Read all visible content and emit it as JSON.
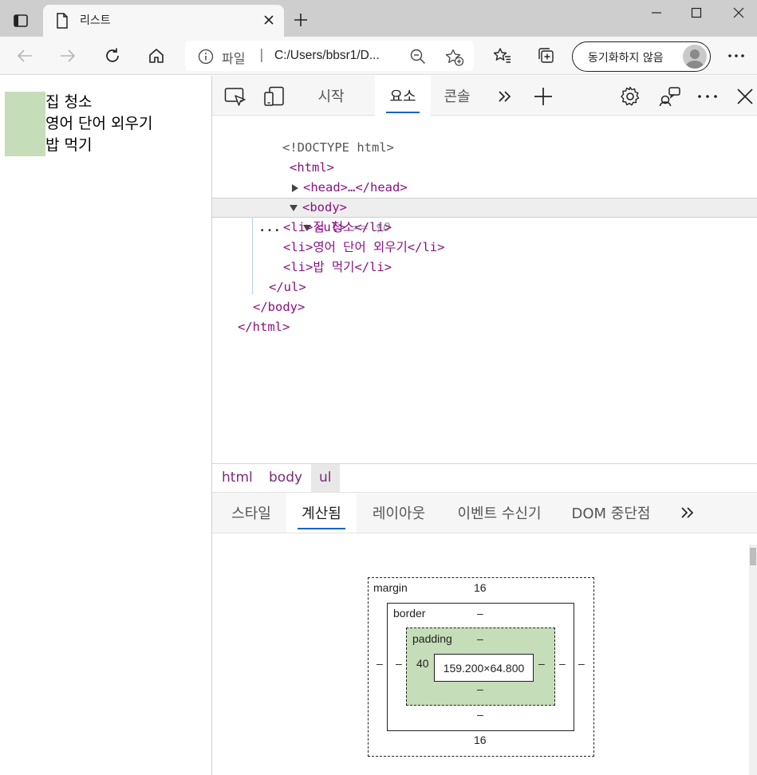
{
  "browser": {
    "tab_title": "리스트",
    "address_scheme": "파일",
    "address_separator": "|",
    "url": "C:/Users/bbsr1/D...",
    "sync_label": "동기화하지 않음"
  },
  "page": {
    "list_items": [
      "집 청소",
      "영어 단어 외우기",
      "밥 먹기"
    ]
  },
  "devtools": {
    "tabs": [
      {
        "label": "시작",
        "active": false
      },
      {
        "label": "요소",
        "active": true
      },
      {
        "label": "콘솔",
        "active": false
      }
    ],
    "dom": {
      "doctype": "<!DOCTYPE html>",
      "html_open": "<html>",
      "head_line": "<head>…</head>",
      "body_open": "<body>",
      "ul_open": "<ul>",
      "selected_marker": "== $0",
      "li_items": [
        "<li>집 청소</li>",
        "<li>영어 단어 외우기</li>",
        "<li>밥 먹기</li>"
      ],
      "ul_close": "</ul>",
      "body_close": "</body>",
      "html_close": "</html>",
      "row_menu": "..."
    },
    "breadcrumb": [
      {
        "label": "html",
        "active": false
      },
      {
        "label": "body",
        "active": false
      },
      {
        "label": "ul",
        "active": true
      }
    ],
    "subtabs": [
      {
        "label": "스타일",
        "active": false
      },
      {
        "label": "계산됨",
        "active": true
      },
      {
        "label": "레이아웃",
        "active": false
      },
      {
        "label": "이벤트 수신기",
        "active": false
      },
      {
        "label": "DOM 중단점",
        "active": false
      }
    ],
    "box_model": {
      "margin_label": "margin",
      "margin_top": "16",
      "margin_bottom": "16",
      "margin_left": "–",
      "margin_right": "–",
      "border_label": "border",
      "border_top": "–",
      "border_bottom": "–",
      "border_left": "–",
      "border_right": "–",
      "padding_label": "padding",
      "padding_top": "–",
      "padding_bottom": "–",
      "padding_left": "40",
      "padding_right": "–",
      "content_size": "159.200×64.800"
    }
  },
  "colors": {
    "highlight_green": "#c5ddb8",
    "tag_purple": "#881280",
    "accent_blue": "#0a66c2"
  }
}
